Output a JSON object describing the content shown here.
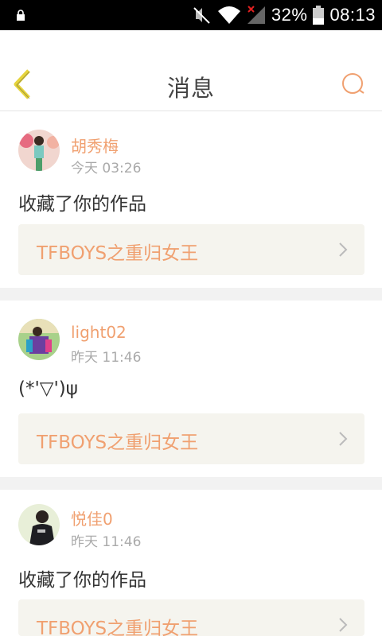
{
  "status_bar": {
    "battery": "32%",
    "time": "08:13",
    "icons": [
      "lock-icon",
      "mute-icon",
      "wifi-icon",
      "signal-icon",
      "battery-icon"
    ]
  },
  "header": {
    "title": "消息",
    "back_icon": "chevron-left-icon",
    "search_icon": "search-icon"
  },
  "colors": {
    "accent": "#f0a070",
    "back_icon": "#e6d43c",
    "card_link_bg": "#f5f4ee",
    "separator": "#f2f2f2"
  },
  "messages": [
    {
      "user": "胡秀梅",
      "time": "今天 03:26",
      "content": "收藏了你的作品",
      "work": "TFBOYS之重归女王"
    },
    {
      "user": "light02",
      "time": "昨天 11:46",
      "content": "(*'▽')ψ",
      "work": "TFBOYS之重归女王"
    },
    {
      "user": "悦佳0",
      "time": "昨天 11:46",
      "content": "收藏了你的作品",
      "work": "TFBOYS之重归女王"
    }
  ]
}
